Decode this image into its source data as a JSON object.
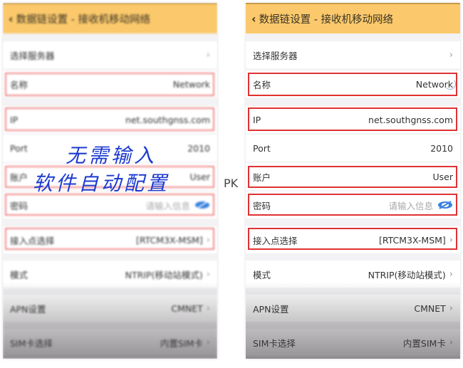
{
  "screen": {
    "header": {
      "back_icon": "chevron-left-icon",
      "title": "数据链设置 - 接收机移动网络"
    },
    "rows": [
      {
        "label": "选择服务器",
        "value": "",
        "chevron": true
      },
      {
        "label": "名称",
        "value": "Network",
        "chevron": false
      },
      {
        "label": "IP",
        "value": "net.southgnss.com",
        "chevron": false
      },
      {
        "label": "Port",
        "value": "2010",
        "chevron": false
      },
      {
        "label": "账户",
        "value": "User",
        "chevron": false
      },
      {
        "label": "密码",
        "placeholder": "请输入信息",
        "icon": "eye-hidden-icon"
      },
      {
        "label": "接入点选择",
        "value": "[RTCM3X-MSM]",
        "chevron": true
      },
      {
        "label": "模式",
        "value": "NTRIP(移动站模式)",
        "chevron": true
      },
      {
        "label": "APN设置",
        "value": "CMNET",
        "chevron": true
      },
      {
        "label": "SIM卡选择",
        "value": "内置SIM卡",
        "chevron": true
      }
    ],
    "chevron_glyph": "›"
  },
  "annotation": {
    "line1": "无需输入",
    "line2": "软件自动配置",
    "separator": "PK"
  },
  "colors": {
    "header": "#fbc96b",
    "highlight": "#e03131",
    "annotation": "#1c3bd1",
    "eye": "#3b82e0"
  }
}
